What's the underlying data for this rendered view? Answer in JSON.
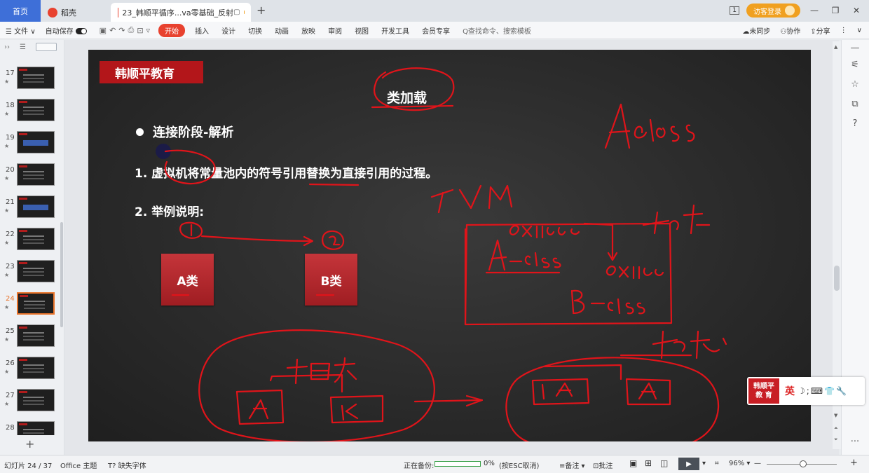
{
  "tabs": {
    "home": "首页",
    "daoke": "稻壳",
    "doc": "23_韩顺平循序...va零基础_反射",
    "new_tab": "+"
  },
  "titlebar": {
    "visitor_login": "访客登录",
    "min": "—",
    "restore": "❐",
    "close": "✕",
    "page_icon": "1"
  },
  "menu": {
    "file": "☰ 文件 ∨",
    "autosave": "自动保存",
    "start": "开始",
    "items": [
      "插入",
      "设计",
      "切换",
      "动画",
      "放映",
      "审阅",
      "视图",
      "开发工具",
      "会员专享"
    ],
    "search": "Q查找命令、搜索模板",
    "sync": "未同步",
    "collab": "协作",
    "share": "分享"
  },
  "thumbs": [
    {
      "num": "17",
      "star": "★"
    },
    {
      "num": "18",
      "star": "★"
    },
    {
      "num": "19",
      "star": "★"
    },
    {
      "num": "20",
      "star": "★"
    },
    {
      "num": "21",
      "star": "★"
    },
    {
      "num": "22",
      "star": "★"
    },
    {
      "num": "23",
      "star": "★"
    },
    {
      "num": "24",
      "star": "★"
    },
    {
      "num": "25",
      "star": "★"
    },
    {
      "num": "26",
      "star": "★"
    },
    {
      "num": "27",
      "star": "★"
    },
    {
      "num": "28",
      "star": ""
    }
  ],
  "slide": {
    "brand": "韩顺平教育",
    "title": "类加载",
    "bullet": "连接阶段-解析",
    "item1": "1.  虚拟机将常量池内的符号引用替换为直接引用的过程。",
    "item2": "2.  举例说明:",
    "box_a": "A类",
    "box_b": "B类"
  },
  "ime": {
    "logo_line1": "韩顺平",
    "logo_line2": "教 育",
    "lang": "英",
    "rest": "☽;⌨👕🔧"
  },
  "status": {
    "slide_pos": "幻灯片 24 / 37",
    "theme": "Office 主题",
    "missing_font": "T? 缺失字体",
    "backup": "正在备份:",
    "backup_pct": "0%",
    "backup_hint": "(按ESC取消)",
    "notes": "≡备注 ▾",
    "comments": "批注",
    "zoom": "96% ▾",
    "minus": "—",
    "plus": "+"
  },
  "colors": {
    "accent": "#e8422f",
    "brand_red": "#b3161a",
    "ink": "#e0141a"
  }
}
